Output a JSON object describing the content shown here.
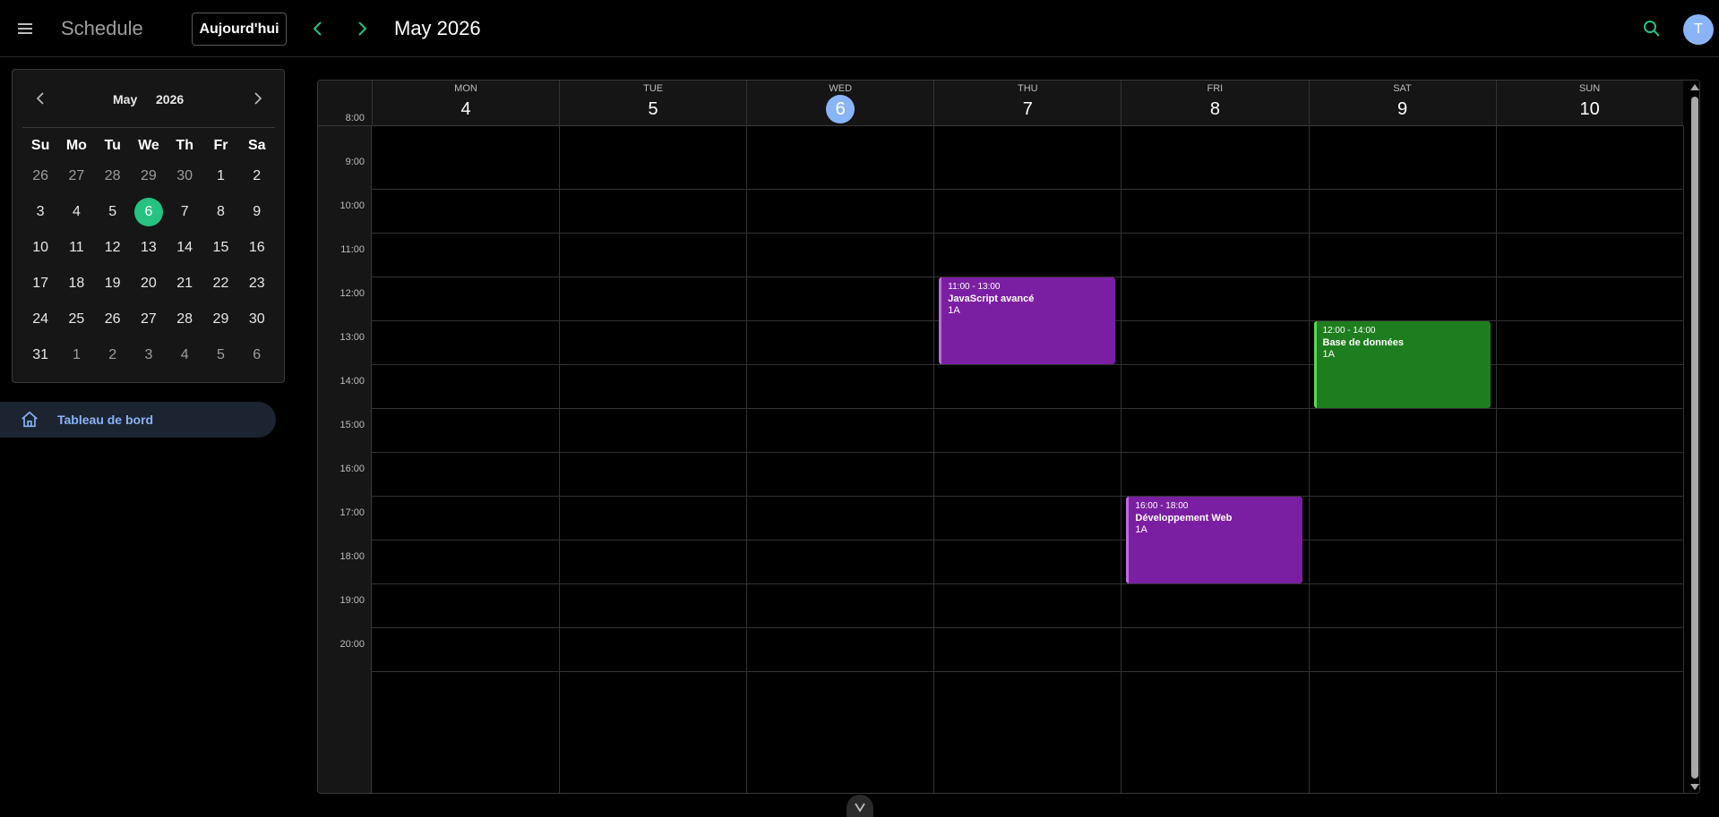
{
  "app": {
    "title": "Schedule"
  },
  "toolbar": {
    "today_label": "Aujourd'hui",
    "period_title": "May 2026",
    "avatar_initial": "T",
    "accent_color": "#26c281"
  },
  "mini_calendar": {
    "month": "May",
    "year": "2026",
    "weekdays": [
      "Su",
      "Mo",
      "Tu",
      "We",
      "Th",
      "Fr",
      "Sa"
    ],
    "weeks": [
      [
        "26",
        "27",
        "28",
        "29",
        "30",
        "1",
        "2"
      ],
      [
        "3",
        "4",
        "5",
        "6",
        "7",
        "8",
        "9"
      ],
      [
        "10",
        "11",
        "12",
        "13",
        "14",
        "15",
        "16"
      ],
      [
        "17",
        "18",
        "19",
        "20",
        "21",
        "22",
        "23"
      ],
      [
        "24",
        "25",
        "26",
        "27",
        "28",
        "29",
        "30"
      ],
      [
        "31",
        "1",
        "2",
        "3",
        "4",
        "5",
        "6"
      ]
    ],
    "selected_day": "6"
  },
  "sidebar": {
    "items": [
      {
        "label": "Tableau de bord",
        "icon": "home-icon"
      }
    ]
  },
  "calendar": {
    "days": [
      {
        "name": "MON",
        "num": "4"
      },
      {
        "name": "TUE",
        "num": "5"
      },
      {
        "name": "WED",
        "num": "6"
      },
      {
        "name": "THU",
        "num": "7"
      },
      {
        "name": "FRI",
        "num": "8"
      },
      {
        "name": "SAT",
        "num": "9"
      },
      {
        "name": "SUN",
        "num": "10"
      }
    ],
    "today_index": 2,
    "hours": [
      "8:00",
      "9:00",
      "10:00",
      "11:00",
      "12:00",
      "13:00",
      "14:00",
      "15:00",
      "16:00",
      "17:00",
      "18:00",
      "19:00",
      "20:00"
    ],
    "events": [
      {
        "time": "11:00 - 13:00",
        "title": "JavaScript avancé",
        "group": "1A",
        "color": "#7b1fa2"
      },
      {
        "time": "12:00 - 14:00",
        "title": "Base de données",
        "group": "1A",
        "color": "#1e7d1e"
      },
      {
        "time": "16:00 - 18:00",
        "title": "Développement Web",
        "group": "1A",
        "color": "#7b1fa2"
      }
    ]
  }
}
